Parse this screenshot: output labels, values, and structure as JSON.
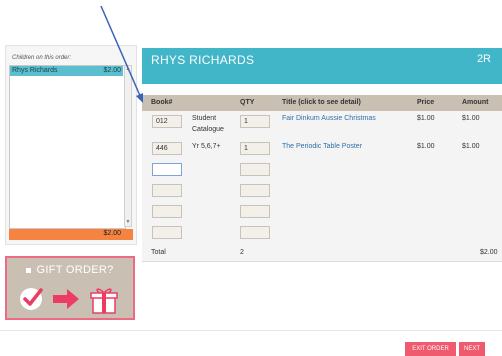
{
  "sidebar": {
    "label": "Children on this order:",
    "children": [
      {
        "name": "Rhys Richards",
        "amount": "$2.00"
      }
    ],
    "total": "$2.00"
  },
  "gift": {
    "title": "GIFT ORDER?"
  },
  "header": {
    "student_name": "RHYS RICHARDS",
    "class": "2R"
  },
  "table": {
    "headers": {
      "book": "Book#",
      "qty": "QTY",
      "title": "Title (click to see detail)",
      "price": "Price",
      "amount": "Amount"
    },
    "rows": [
      {
        "book": "012",
        "category_line1": "Student",
        "category_line2": "Catalogue",
        "qty": "1",
        "title": "Fair Dinkum Aussie Christmas",
        "price": "$1.00",
        "amount": "$1.00"
      },
      {
        "book": "446",
        "category_line1": "Yr 5,6,7+",
        "category_line2": "",
        "qty": "1",
        "title": "The Periodic Table Poster",
        "price": "$1.00",
        "amount": "$1.00"
      }
    ],
    "empty_rows": 4,
    "total_label": "Total",
    "total_qty": "2",
    "total_amount": "$2.00"
  },
  "buttons": {
    "exit": "EXIT ORDER",
    "next": "NEXT"
  },
  "colors": {
    "header": "#40b6c8",
    "accent_orange": "#f58342",
    "gift_border": "#ec6a84",
    "button": "#f05a6e",
    "arrow_annotation": "#3a63b8"
  }
}
